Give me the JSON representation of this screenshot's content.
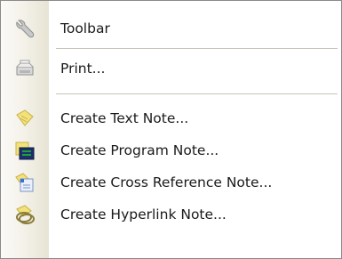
{
  "menu": {
    "items": [
      {
        "label": "Toolbar",
        "icon": "wrench-icon"
      },
      {
        "label": "Print...",
        "icon": "printer-icon"
      },
      {
        "label": "Create Text Note...",
        "icon": "text-note-icon"
      },
      {
        "label": "Create Program Note...",
        "icon": "program-note-icon"
      },
      {
        "label": "Create Cross Reference Note...",
        "icon": "cross-reference-note-icon"
      },
      {
        "label": "Create Hyperlink Note...",
        "icon": "hyperlink-note-icon"
      }
    ]
  },
  "colors": {
    "border": "#8a8a8a",
    "separator": "#c9c6b8",
    "note_yellow": "#f3e27a",
    "note_blue": "#3a6fd8",
    "program_green": "#1e9f3a"
  }
}
